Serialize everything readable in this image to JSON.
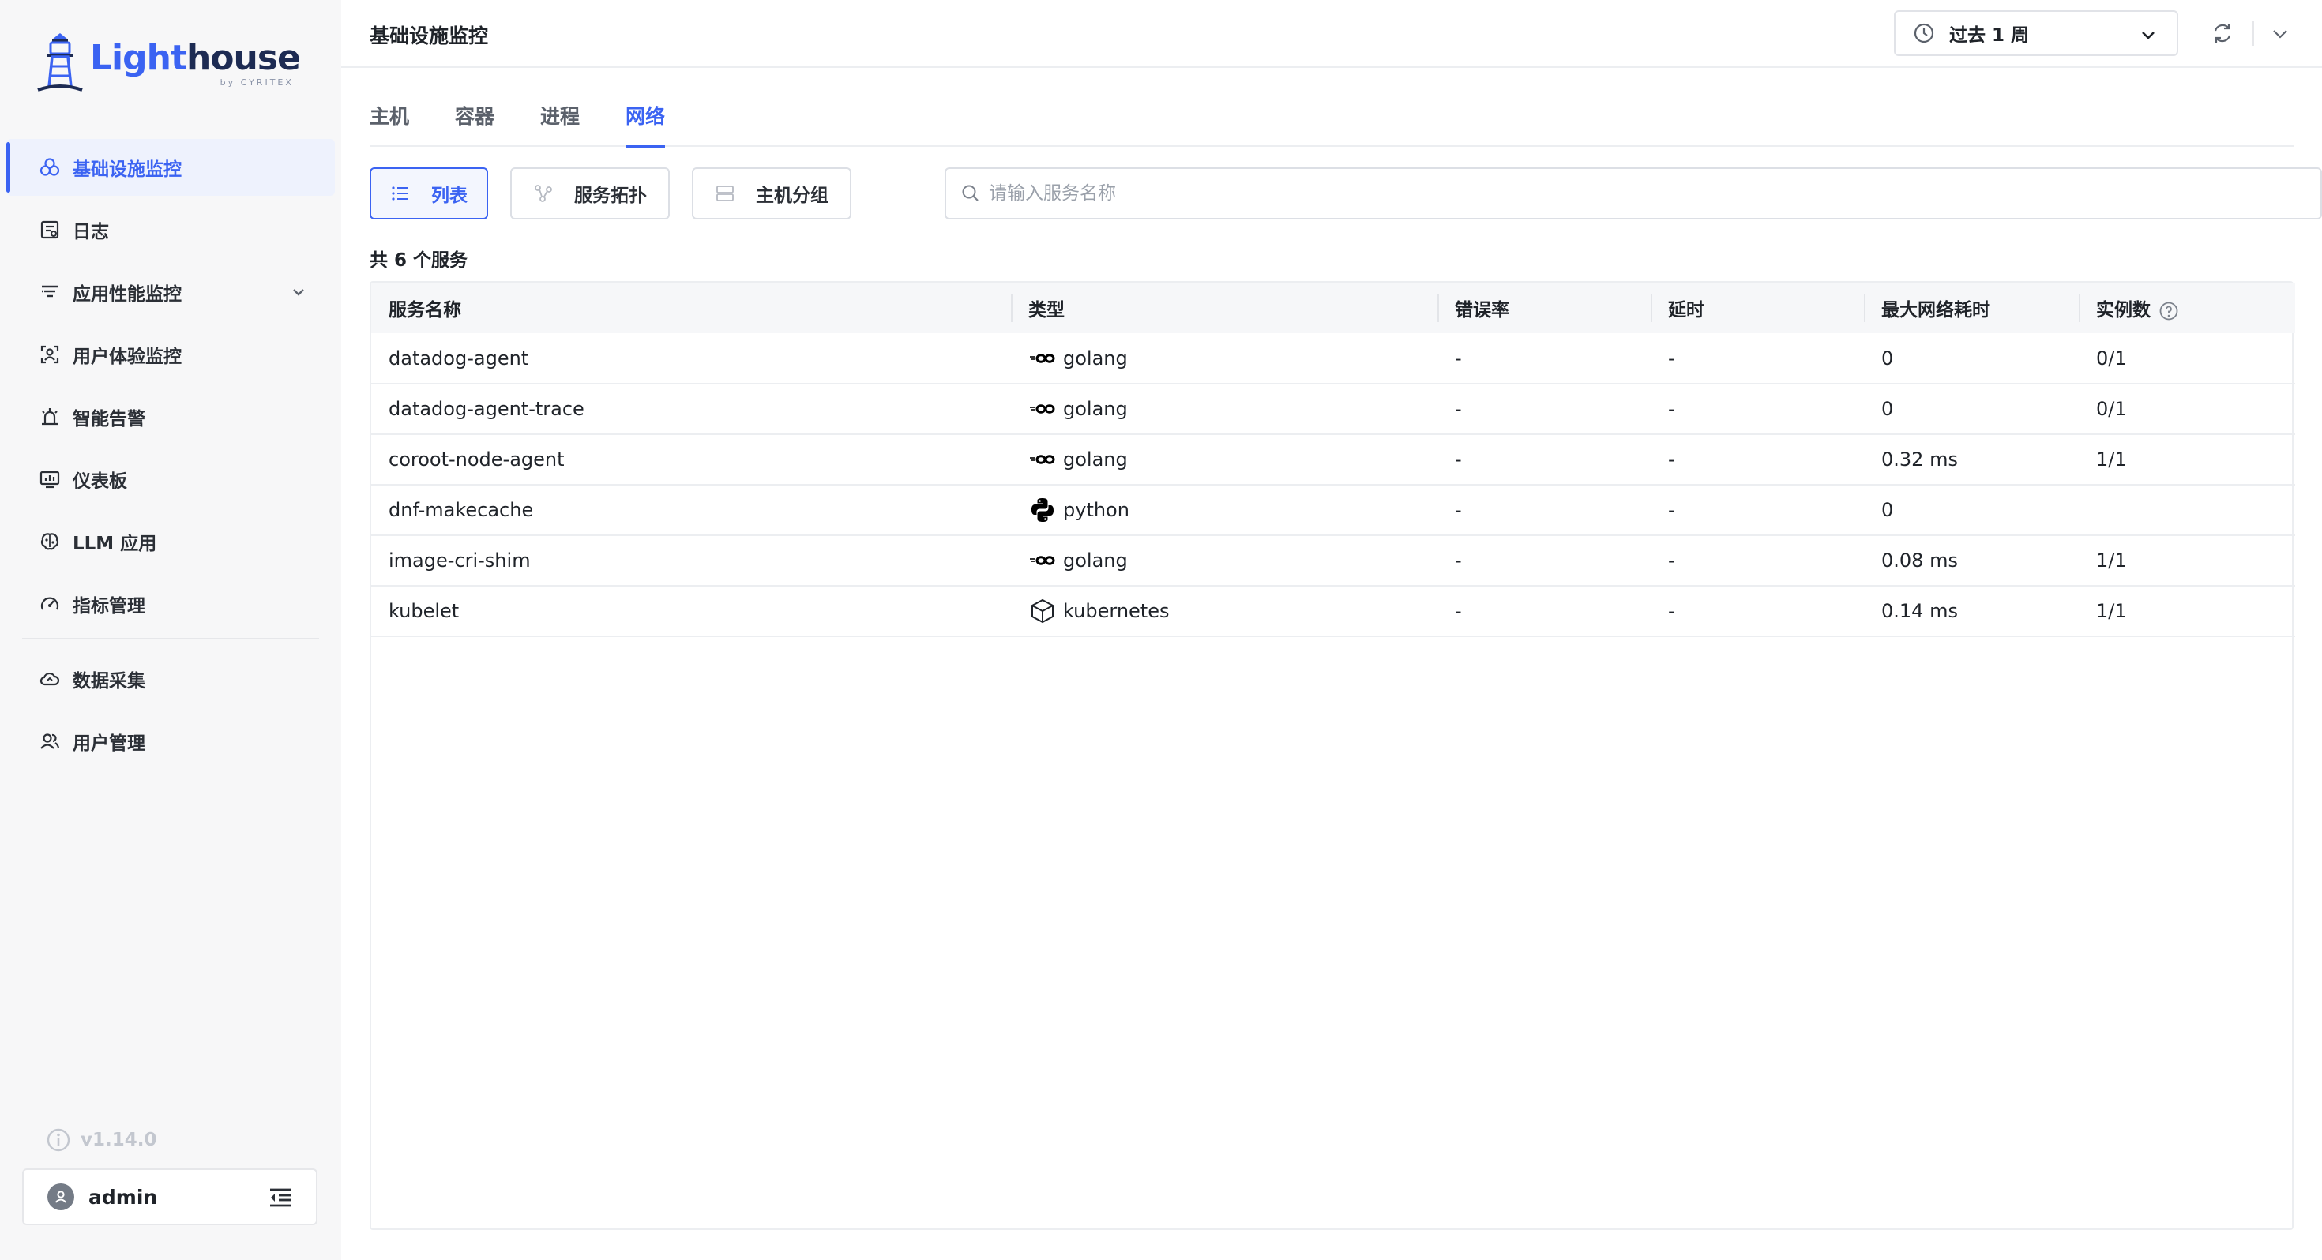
{
  "app": {
    "brand_light": "Light",
    "brand_house": "house",
    "brand_by": "by CYRITEX"
  },
  "sidebar": {
    "items": [
      {
        "label": "基础设施监控",
        "icon": "infrastructure-icon"
      },
      {
        "label": "日志",
        "icon": "log-icon"
      },
      {
        "label": "应用性能监控",
        "icon": "apm-icon"
      },
      {
        "label": "用户体验监控",
        "icon": "user-experience-icon"
      },
      {
        "label": "智能告警",
        "icon": "alarm-icon"
      },
      {
        "label": "仪表板",
        "icon": "dashboard-icon"
      },
      {
        "label": "LLM 应用",
        "icon": "llm-brain-icon"
      },
      {
        "label": "指标管理",
        "icon": "gauge-icon"
      },
      {
        "label": "数据采集",
        "icon": "cloud-collect-icon"
      },
      {
        "label": "用户管理",
        "icon": "users-icon"
      }
    ],
    "version": "v1.14.0",
    "user": "admin"
  },
  "header": {
    "title": "基础设施监控",
    "time_range": "过去 1 周"
  },
  "tabs": [
    "主机",
    "容器",
    "进程",
    "网络"
  ],
  "active_tab": "网络",
  "toolbar": {
    "list": "列表",
    "topology": "服务拓扑",
    "host_group": "主机分组",
    "search_placeholder": "请输入服务名称"
  },
  "count_text": "共 6 个服务",
  "table": {
    "columns": [
      "服务名称",
      "类型",
      "错误率",
      "延时",
      "最大网络耗时",
      "实例数"
    ],
    "rows": [
      {
        "name": "datadog-agent",
        "type": "golang",
        "error_rate": "-",
        "latency": "-",
        "max_net": "0",
        "instances": "0/1"
      },
      {
        "name": "datadog-agent-trace",
        "type": "golang",
        "error_rate": "-",
        "latency": "-",
        "max_net": "0",
        "instances": "0/1"
      },
      {
        "name": "coroot-node-agent",
        "type": "golang",
        "error_rate": "-",
        "latency": "-",
        "max_net": "0.32 ms",
        "instances": "1/1"
      },
      {
        "name": "dnf-makecache",
        "type": "python",
        "error_rate": "-",
        "latency": "-",
        "max_net": "0",
        "instances": ""
      },
      {
        "name": "image-cri-shim",
        "type": "golang",
        "error_rate": "-",
        "latency": "-",
        "max_net": "0.08 ms",
        "instances": "1/1"
      },
      {
        "name": "kubelet",
        "type": "kubernetes",
        "error_rate": "-",
        "latency": "-",
        "max_net": "0.14 ms",
        "instances": "1/1"
      }
    ]
  },
  "colors": {
    "accent": "#3b63f2",
    "sidebar_bg": "#f7f7f8",
    "brand_dark": "#1d2b53"
  }
}
